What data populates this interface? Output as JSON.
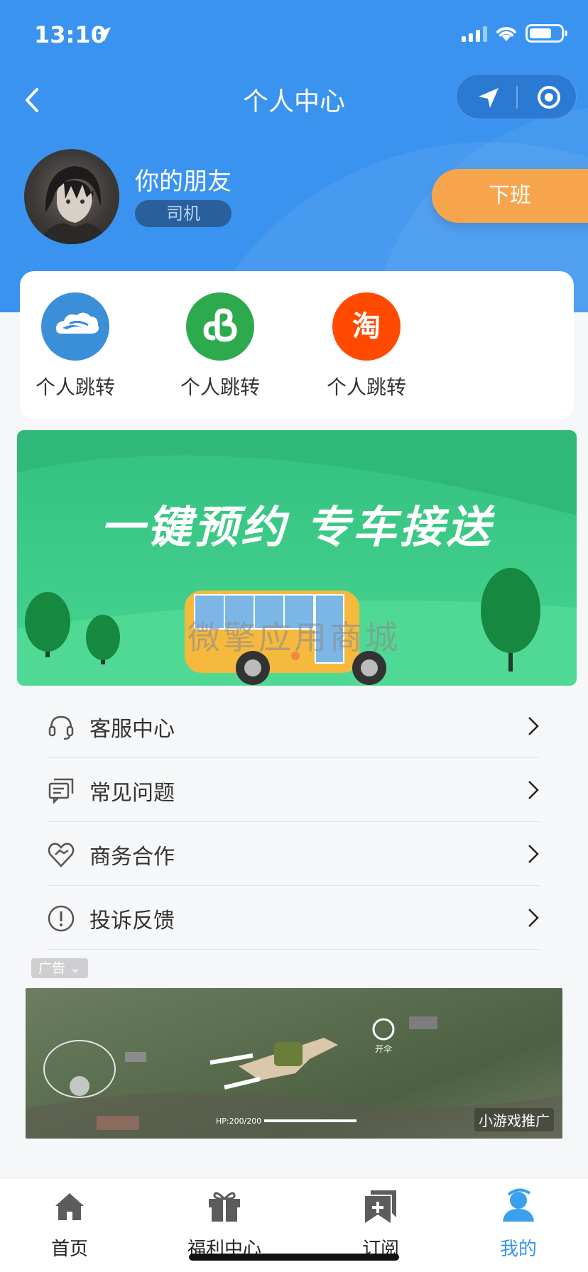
{
  "status_bar": {
    "time": "13:10"
  },
  "nav": {
    "title": "个人中心"
  },
  "profile": {
    "name": "你的朋友",
    "role": "司机",
    "offwork_label": "下班"
  },
  "quick_links": [
    {
      "label": "个人跳转",
      "icon": "cloud-icon",
      "color": "#3b8fd8"
    },
    {
      "label": "个人跳转",
      "icon": "mini-program-icon",
      "color": "#2eaa4e"
    },
    {
      "label": "个人跳转",
      "icon": "taobao-icon",
      "color": "#ff4a00",
      "glyph": "淘"
    }
  ],
  "banner": {
    "text": "一键预约 专车接送",
    "watermark": "微擎应用商城"
  },
  "menu": [
    {
      "label": "客服中心",
      "icon": "headset-icon"
    },
    {
      "label": "常见问题",
      "icon": "chat-icon"
    },
    {
      "label": "商务合作",
      "icon": "handshake-heart-icon"
    },
    {
      "label": "投诉反馈",
      "icon": "exclamation-icon"
    }
  ],
  "ad": {
    "tag": "广告",
    "caption": "小游戏推广",
    "hp_text": "HP:200/200",
    "parachute_text": "开伞"
  },
  "tabbar": [
    {
      "label": "首页",
      "icon": "home-icon"
    },
    {
      "label": "福利中心",
      "icon": "gift-icon"
    },
    {
      "label": "订阅",
      "icon": "bookmark-plus-icon"
    },
    {
      "label": "我的",
      "icon": "user-icon",
      "active": true
    }
  ],
  "colors": {
    "primary": "#3a93ee",
    "accent": "#f6a54c",
    "banner": "#3fcb88"
  }
}
